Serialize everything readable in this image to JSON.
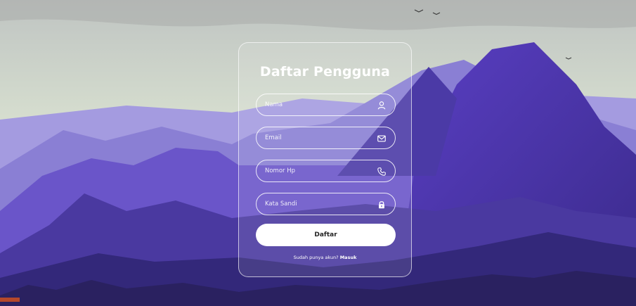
{
  "form": {
    "title": "Daftar Pengguna",
    "fields": [
      {
        "placeholder": "Nama",
        "icon": "user-icon"
      },
      {
        "placeholder": "Email",
        "icon": "mail-icon"
      },
      {
        "placeholder": "Nomor Hp",
        "icon": "phone-icon"
      },
      {
        "placeholder": "Kata Sandi",
        "icon": "lock-icon"
      }
    ],
    "submit_label": "Daftar",
    "login_prompt": "Sudah punya akun?",
    "login_link": "Masuk"
  },
  "colors": {
    "sky_top": "#c7c9bf",
    "sky_bottom": "#dfe8d4",
    "mountain_light": "#8f85d8",
    "mountain_mid": "#6a55c9",
    "mountain_dark": "#3f2f8f",
    "ground": "#2a2160"
  }
}
